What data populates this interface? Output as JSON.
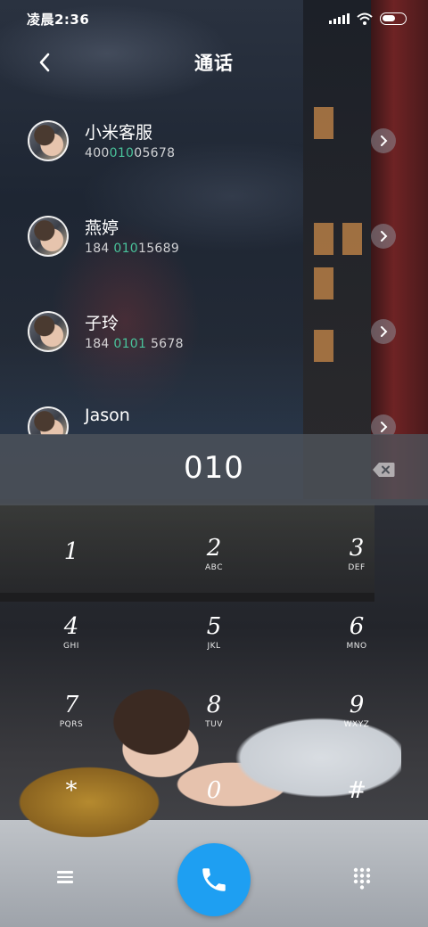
{
  "status_bar": {
    "time": "凌晨2:36",
    "icons": [
      "signal-icon",
      "wifi-icon",
      "battery-icon"
    ]
  },
  "header": {
    "title": "通话",
    "back_icon": "chevron-left-icon"
  },
  "contacts": [
    {
      "name": "小米客服",
      "number_before": "400",
      "number_match": "010",
      "number_after": "05678"
    },
    {
      "name": "燕婷",
      "number_before": "184 ",
      "number_match": "010",
      "number_after": "15689"
    },
    {
      "name": "子玲",
      "number_before": "184 ",
      "number_match": "0101",
      "number_after": " 5678"
    },
    {
      "name": "Jason",
      "number_before": "",
      "number_match": "",
      "number_after": ""
    }
  ],
  "dialer": {
    "dialed_number": "010",
    "backspace_icon": "backspace-icon"
  },
  "keypad": [
    {
      "digit": "1",
      "letters": ""
    },
    {
      "digit": "2",
      "letters": "ABC"
    },
    {
      "digit": "3",
      "letters": "DEF"
    },
    {
      "digit": "4",
      "letters": "GHI"
    },
    {
      "digit": "5",
      "letters": "JKL"
    },
    {
      "digit": "6",
      "letters": "MNO"
    },
    {
      "digit": "7",
      "letters": "PQRS"
    },
    {
      "digit": "8",
      "letters": "TUV"
    },
    {
      "digit": "9",
      "letters": "WXYZ"
    },
    {
      "digit": "*",
      "letters": ""
    },
    {
      "digit": "0",
      "letters": ""
    },
    {
      "digit": "#",
      "letters": ""
    }
  ],
  "bottom_bar": {
    "menu_icon": "hamburger-menu-icon",
    "call_icon": "phone-icon",
    "dialpad_icon": "dialpad-icon"
  },
  "colors": {
    "match_highlight": "#49c39b",
    "call_button": "#1e9ff2"
  }
}
